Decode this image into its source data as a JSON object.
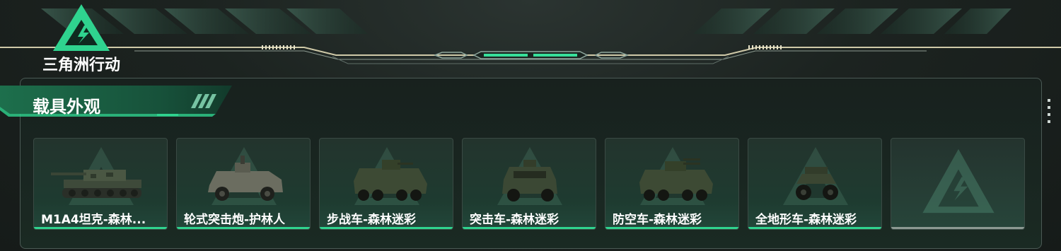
{
  "header": {
    "logo_text": "三角洲行动"
  },
  "section": {
    "title": "载具外观"
  },
  "vehicles": [
    {
      "label": "M1A4坦克-森林...",
      "type": "tank"
    },
    {
      "label": "轮式突击炮-护林人",
      "type": "armored-car"
    },
    {
      "label": "步战车-森林迷彩",
      "type": "ifv"
    },
    {
      "label": "突击车-森林迷彩",
      "type": "assault-vehicle"
    },
    {
      "label": "防空车-森林迷彩",
      "type": "aa-vehicle"
    },
    {
      "label": "全地形车-森林迷彩",
      "type": "atv"
    },
    {
      "label": "",
      "type": "empty"
    }
  ],
  "colors": {
    "accent": "#2fd38f",
    "empty_bar": "#8d9993"
  }
}
